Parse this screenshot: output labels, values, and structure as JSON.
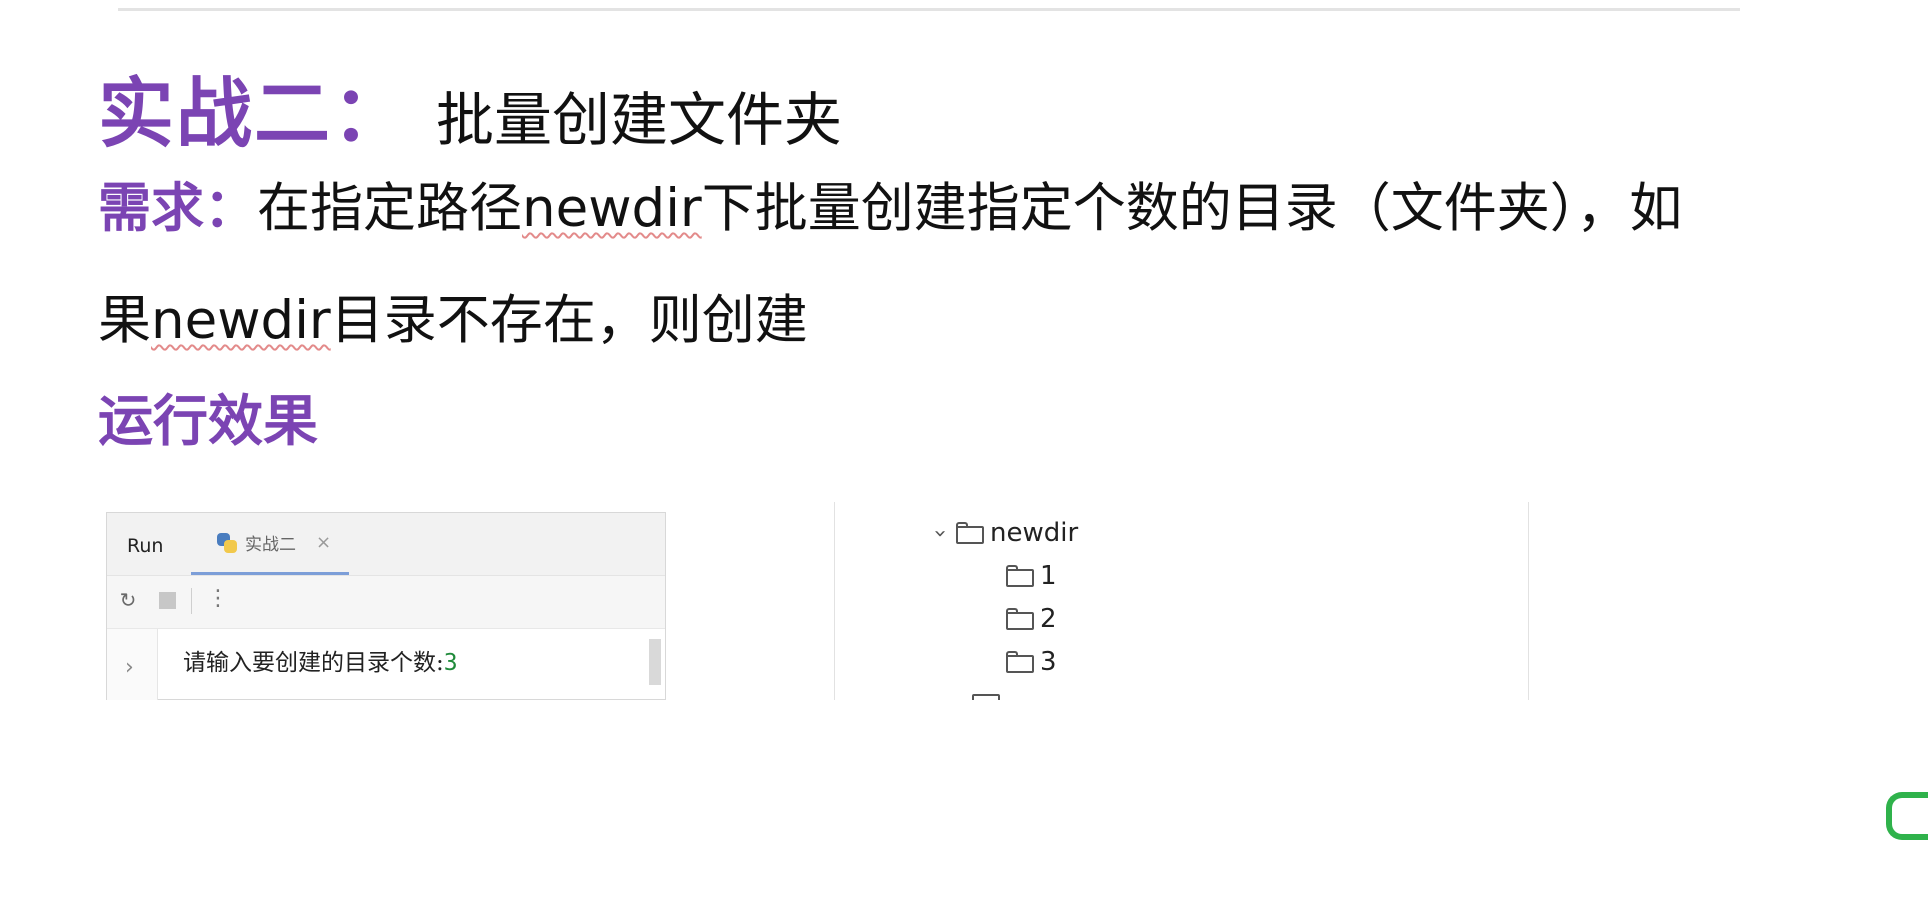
{
  "slide": {
    "title_main": "实战二：",
    "title_sub": "批量创建文件夹",
    "requirement_label": "需求：",
    "requirement_part1": "在指定路径",
    "requirement_code1": "newdir",
    "requirement_part2": "下批量创建指定个数的目录（文件夹），如",
    "requirement_part3": "果",
    "requirement_code2": "newdir",
    "requirement_part4": "目录不存在，则创建",
    "section_heading": "运行效果"
  },
  "run_panel": {
    "run_label": "Run",
    "tab_label": "实战二",
    "tab_close": "×",
    "more_glyph": "⋮",
    "gutter_glyph": "›",
    "console_prompt": "请输入要创建的目录个数:",
    "console_input": "3"
  },
  "project_tree": {
    "root": {
      "name": "newdir",
      "expanded": true
    },
    "children": [
      "1",
      "2",
      "3"
    ]
  },
  "icons": {
    "rerun": "rerun-icon",
    "stop": "stop-icon",
    "more": "more-icon",
    "python": "python-icon",
    "folder": "folder-icon",
    "chevron": "chevron-down-icon",
    "logo": "brand-logo-icon"
  },
  "colors": {
    "accent_purple": "#7b44b3",
    "console_input_green": "#1f8a3a",
    "tab_underline": "#7c9ed8",
    "logo_green": "#2fb24b"
  }
}
